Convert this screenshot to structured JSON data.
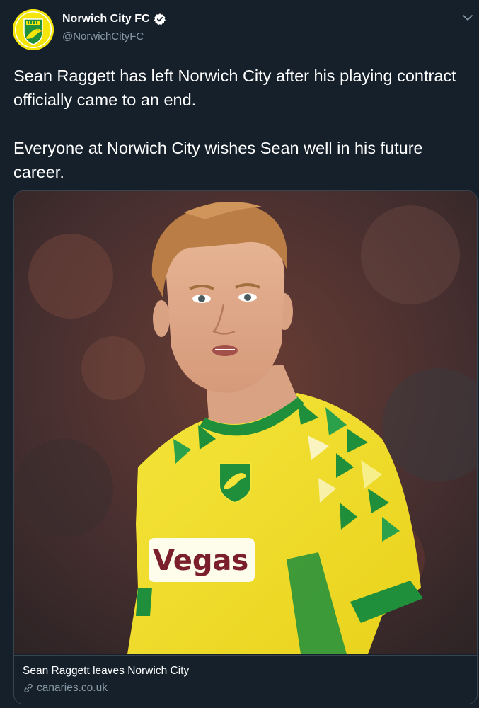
{
  "author": {
    "name": "Norwich City FC",
    "handle": "@NorwichCityFC",
    "verified": true
  },
  "tweet": {
    "paragraphs": [
      "Sean Raggett has left Norwich City after his playing contract officially came to an end.",
      "Everyone at Norwich City wishes Sean well in his future career."
    ]
  },
  "card": {
    "title": "Sean Raggett leaves Norwich City",
    "domain": "canaries.co.uk",
    "image": {
      "shirt_sponsor": "Vegas"
    }
  },
  "icons": {
    "verified": "verified-badge-icon",
    "caret": "chevron-down-icon",
    "link": "link-icon"
  },
  "colors": {
    "background": "#15202b",
    "text_primary": "#ffffff",
    "text_secondary": "#8899a6",
    "border": "#38444d",
    "club_yellow": "#f5e50a",
    "club_green": "#1f8f3c"
  }
}
